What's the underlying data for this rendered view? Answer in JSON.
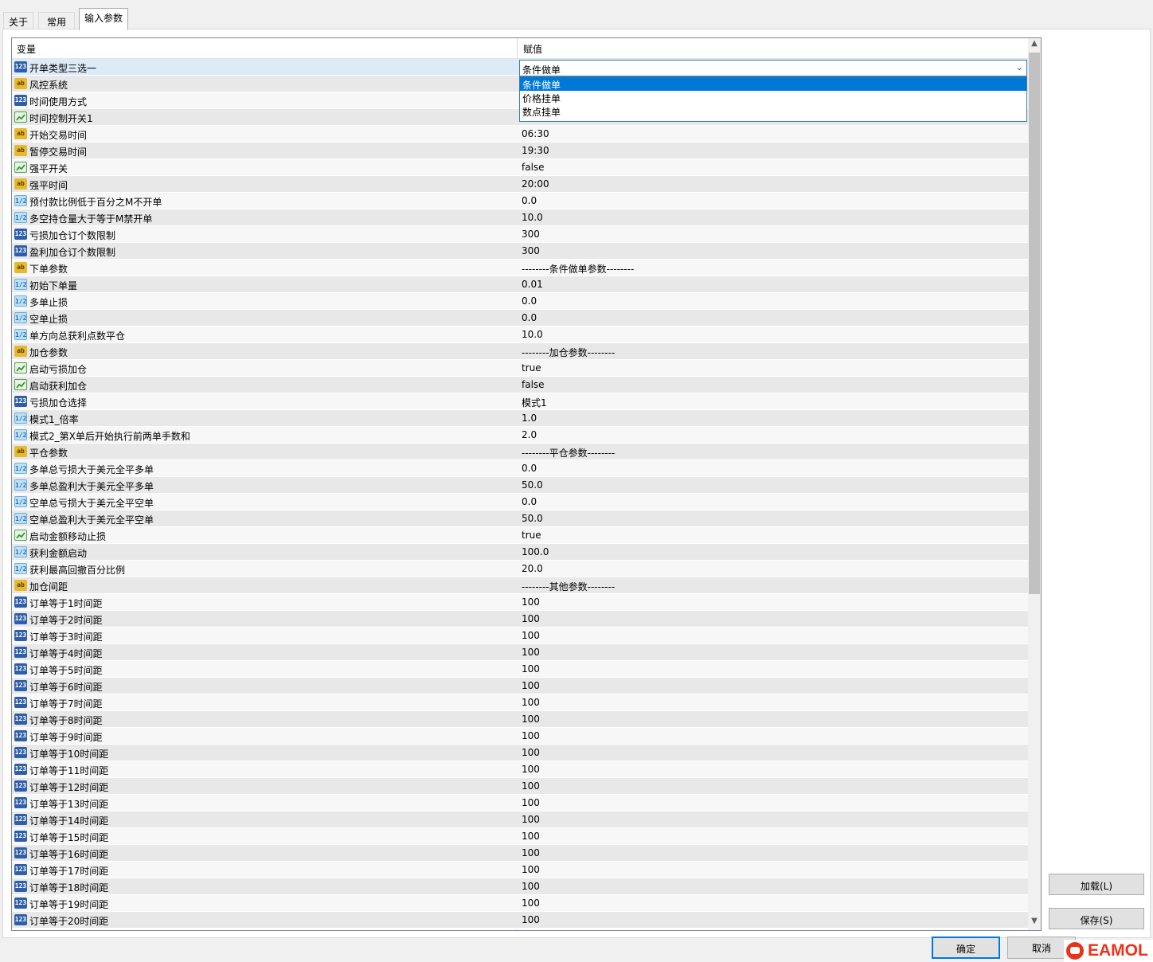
{
  "tabs": [
    {
      "label": "关于",
      "active": false
    },
    {
      "label": "常用",
      "active": false
    },
    {
      "label": "输入参数",
      "active": true
    }
  ],
  "grid": {
    "col_variable": "变量",
    "col_value": "赋值",
    "combo": {
      "value": "条件做单",
      "options": [
        "条件做单",
        "价格挂单",
        "数点挂单"
      ],
      "selected_index": 0
    },
    "rows": [
      {
        "type": "int",
        "name": "开单类型三选一",
        "value": ""
      },
      {
        "type": "str",
        "name": "风控系统",
        "value": ""
      },
      {
        "type": "int",
        "name": "时间使用方式",
        "value": ""
      },
      {
        "type": "bool",
        "name": "时间控制开关1",
        "value": ""
      },
      {
        "type": "str",
        "name": "开始交易时间",
        "value": "06:30"
      },
      {
        "type": "str",
        "name": "暂停交易时间",
        "value": "19:30"
      },
      {
        "type": "bool",
        "name": "强平开关",
        "value": "false"
      },
      {
        "type": "str",
        "name": "强平时间",
        "value": "20:00"
      },
      {
        "type": "dbl",
        "name": "预付款比例低于百分之M不开单",
        "value": "0.0"
      },
      {
        "type": "dbl",
        "name": "多空持仓量大于等于M禁开单",
        "value": "10.0"
      },
      {
        "type": "int",
        "name": "亏损加仓订个数限制",
        "value": "300"
      },
      {
        "type": "int",
        "name": "盈利加仓订个数限制",
        "value": "300"
      },
      {
        "type": "str",
        "name": "下单参数",
        "value": "--------条件做单参数--------"
      },
      {
        "type": "dbl",
        "name": "初始下单量",
        "value": "0.01"
      },
      {
        "type": "dbl",
        "name": "多单止损",
        "value": "0.0"
      },
      {
        "type": "dbl",
        "name": "空单止损",
        "value": "0.0"
      },
      {
        "type": "dbl",
        "name": "单方向总获利点数平仓",
        "value": "10.0"
      },
      {
        "type": "str",
        "name": "加仓参数",
        "value": "--------加仓参数--------"
      },
      {
        "type": "bool",
        "name": "启动亏损加仓",
        "value": "true"
      },
      {
        "type": "bool",
        "name": "启动获利加仓",
        "value": "false"
      },
      {
        "type": "int",
        "name": "亏损加仓选择",
        "value": "模式1"
      },
      {
        "type": "dbl",
        "name": "模式1_倍率",
        "value": "1.0"
      },
      {
        "type": "dbl",
        "name": "模式2_第X单后开始执行前两单手数和",
        "value": "2.0"
      },
      {
        "type": "str",
        "name": "平仓参数",
        "value": "--------平仓参数--------"
      },
      {
        "type": "dbl",
        "name": "多单总亏损大于美元全平多单",
        "value": "0.0"
      },
      {
        "type": "dbl",
        "name": "多单总盈利大于美元全平多单",
        "value": "50.0"
      },
      {
        "type": "dbl",
        "name": "空单总亏损大于美元全平空单",
        "value": "0.0"
      },
      {
        "type": "dbl",
        "name": "空单总盈利大于美元全平空单",
        "value": "50.0"
      },
      {
        "type": "bool",
        "name": "启动金额移动止损",
        "value": "true"
      },
      {
        "type": "dbl",
        "name": "获利金额启动",
        "value": "100.0"
      },
      {
        "type": "dbl",
        "name": "获利最高回撤百分比例",
        "value": "20.0"
      },
      {
        "type": "str",
        "name": "加仓间距",
        "value": "--------其他参数--------"
      },
      {
        "type": "int",
        "name": "订单等于1时间距",
        "value": "100"
      },
      {
        "type": "int",
        "name": "订单等于2时间距",
        "value": "100"
      },
      {
        "type": "int",
        "name": "订单等于3时间距",
        "value": "100"
      },
      {
        "type": "int",
        "name": "订单等于4时间距",
        "value": "100"
      },
      {
        "type": "int",
        "name": "订单等于5时间距",
        "value": "100"
      },
      {
        "type": "int",
        "name": "订单等于6时间距",
        "value": "100"
      },
      {
        "type": "int",
        "name": "订单等于7时间距",
        "value": "100"
      },
      {
        "type": "int",
        "name": "订单等于8时间距",
        "value": "100"
      },
      {
        "type": "int",
        "name": "订单等于9时间距",
        "value": "100"
      },
      {
        "type": "int",
        "name": "订单等于10时间距",
        "value": "100"
      },
      {
        "type": "int",
        "name": "订单等于11时间距",
        "value": "100"
      },
      {
        "type": "int",
        "name": "订单等于12时间距",
        "value": "100"
      },
      {
        "type": "int",
        "name": "订单等于13时间距",
        "value": "100"
      },
      {
        "type": "int",
        "name": "订单等于14时间距",
        "value": "100"
      },
      {
        "type": "int",
        "name": "订单等于15时间距",
        "value": "100"
      },
      {
        "type": "int",
        "name": "订单等于16时间距",
        "value": "100"
      },
      {
        "type": "int",
        "name": "订单等于17时间距",
        "value": "100"
      },
      {
        "type": "int",
        "name": "订单等于18时间距",
        "value": "100"
      },
      {
        "type": "int",
        "name": "订单等于19时间距",
        "value": "100"
      },
      {
        "type": "int",
        "name": "订单等于20时间距",
        "value": "100"
      }
    ]
  },
  "buttons": {
    "load": "加载(L)",
    "save": "保存(S)",
    "ok": "确定",
    "cancel": "取消"
  },
  "icon_labels": {
    "int": "123",
    "str": "ab",
    "dbl": "1/2"
  },
  "watermark": "EAMOL",
  "colors": {
    "selection": "#0078d7",
    "combo_border": "#3c7fb1",
    "logo": "#e8341c"
  }
}
